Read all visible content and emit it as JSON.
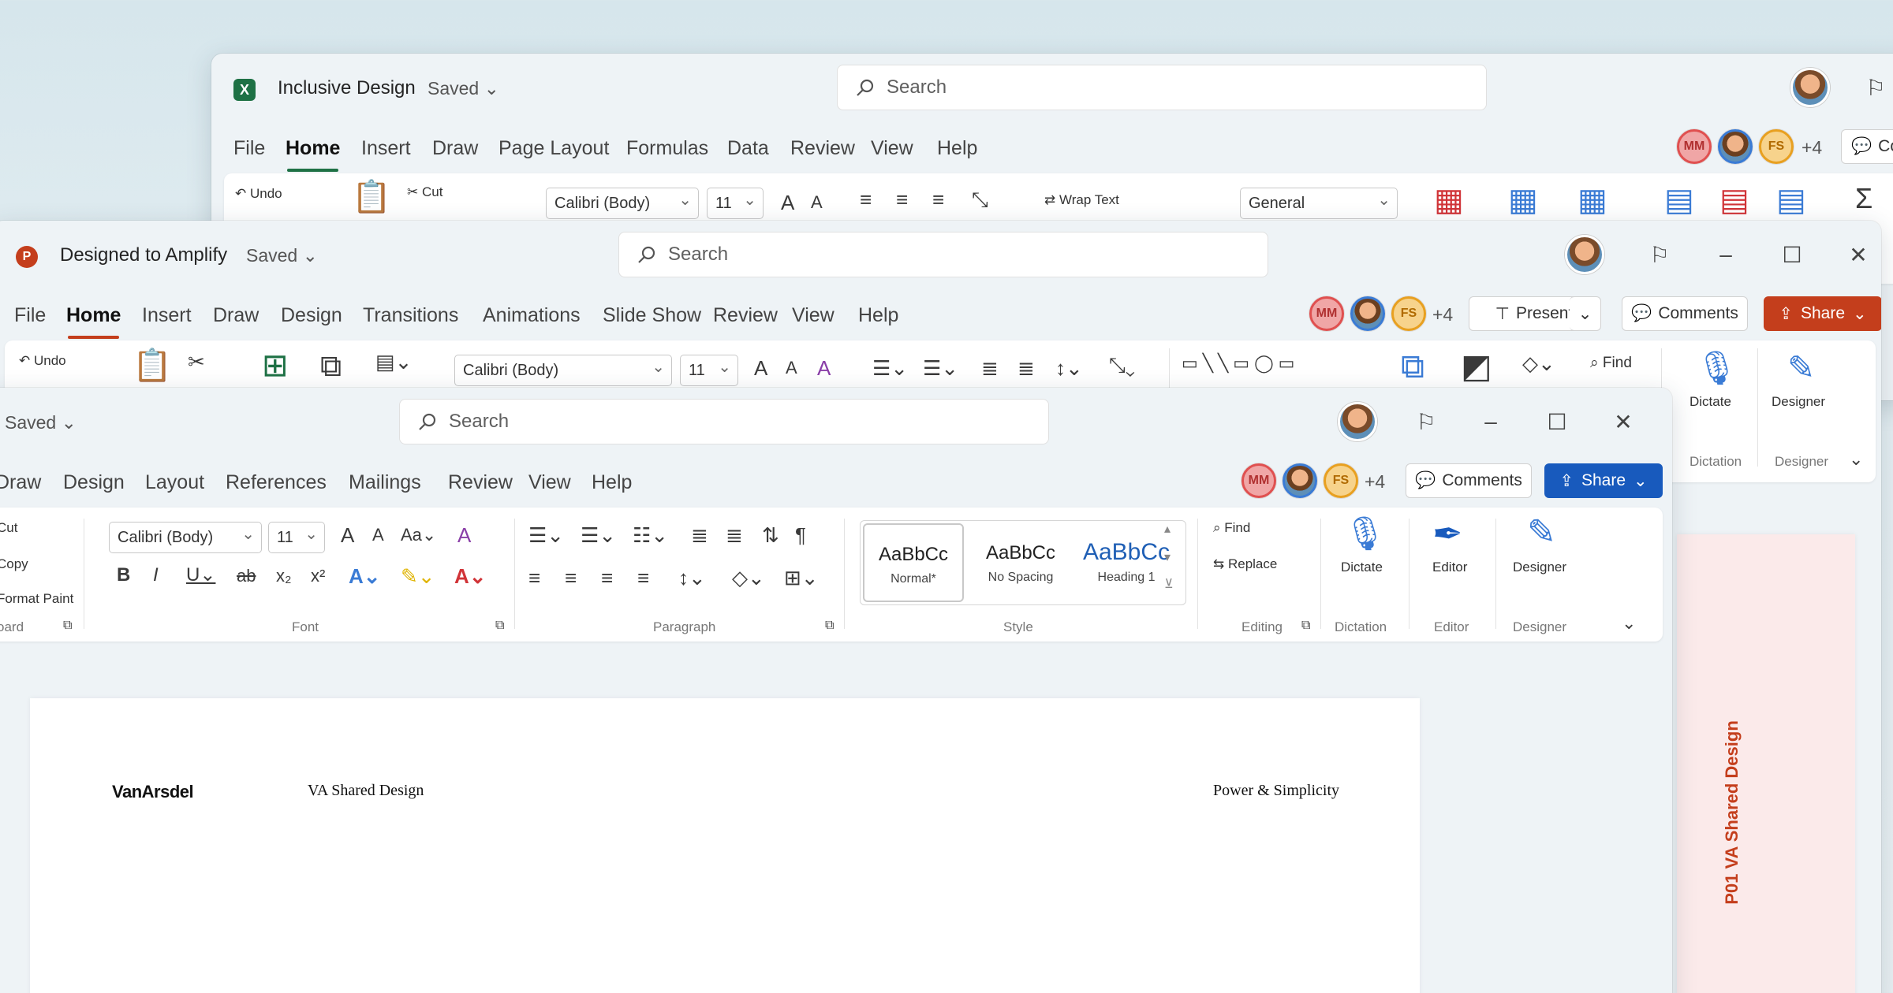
{
  "excel": {
    "title": "Inclusive Design",
    "saved": "Saved",
    "search": "Search",
    "accent": "#1e7145",
    "tabs": [
      "File",
      "Home",
      "Insert",
      "Draw",
      "Page Layout",
      "Formulas",
      "Data",
      "Review",
      "View",
      "Help"
    ],
    "active_tab": "Home",
    "collab_mm": "MM",
    "collab_fs": "FS",
    "collab_more": "+4",
    "comments_partial": "Co",
    "ribbon": {
      "undo": "Undo",
      "cut": "Cut",
      "font": "Calibri (Body)",
      "size": "11",
      "wrap": "Wrap Text",
      "format": "General"
    }
  },
  "ppt": {
    "title": "Designed to Amplify",
    "saved": "Saved",
    "search": "Search",
    "accent": "#c43e1c",
    "tabs": [
      "File",
      "Home",
      "Insert",
      "Draw",
      "Design",
      "Transitions",
      "Animations",
      "Slide Show",
      "Review",
      "View",
      "Help"
    ],
    "active_tab": "Home",
    "collab_mm": "MM",
    "collab_fs": "FS",
    "collab_more": "+4",
    "present": "Present",
    "comments": "Comments",
    "share": "Share",
    "ribbon": {
      "undo": "Undo",
      "font": "Calibri (Body)",
      "size": "11",
      "find": "Find",
      "dictate": "Dictate",
      "designer": "Designer",
      "group_dictation": "Dictation",
      "group_designer": "Designer"
    },
    "slide_text": "P01  VA Shared Design"
  },
  "word": {
    "saved": "Saved",
    "search": "Search",
    "accent": "#185abd",
    "tabs": [
      "Draw",
      "Design",
      "Layout",
      "References",
      "Mailings",
      "Review",
      "View",
      "Help"
    ],
    "collab_mm": "MM",
    "collab_fs": "FS",
    "collab_more": "+4",
    "comments": "Comments",
    "share": "Share",
    "ribbon": {
      "cut": "Cut",
      "copy": "Copy",
      "format_paint": "Format Paint",
      "group_clipboard": "oard",
      "font": "Calibri (Body)",
      "size": "11",
      "group_font": "Font",
      "group_paragraph": "Paragraph",
      "styles": [
        {
          "sample": "AaBbCc",
          "name": "Normal*"
        },
        {
          "sample": "AaBbCc",
          "name": "No Spacing"
        },
        {
          "sample": "AaBbCc",
          "name": "Heading 1"
        }
      ],
      "group_style": "Style",
      "find": "Find",
      "replace": "Replace",
      "group_editing": "Editing",
      "dictate": "Dictate",
      "group_dictation": "Dictation",
      "editor": "Editor",
      "group_editor": "Editor",
      "designer": "Designer",
      "group_designer": "Designer"
    },
    "document": {
      "logo": "VanArsdel",
      "header_left": "VA Shared Design",
      "header_right": "Power & Simplicity"
    }
  }
}
